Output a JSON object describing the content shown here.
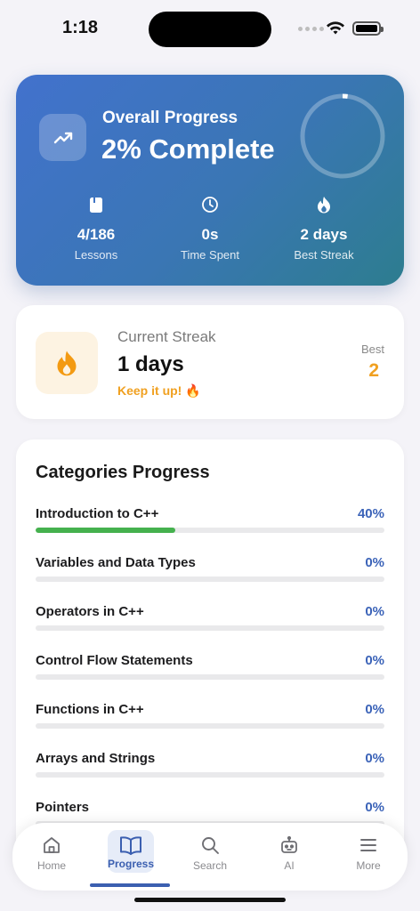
{
  "status_bar": {
    "time": "1:18"
  },
  "hero": {
    "title": "Overall Progress",
    "value": "2% Complete",
    "progress_fraction": 0.02,
    "stats": [
      {
        "icon": "book-icon",
        "value": "4/186",
        "label": "Lessons"
      },
      {
        "icon": "clock-icon",
        "value": "0s",
        "label": "Time Spent"
      },
      {
        "icon": "flame-icon",
        "value": "2 days",
        "label": "Best Streak"
      }
    ]
  },
  "streak": {
    "label": "Current Streak",
    "value": "1 days",
    "cheer": "Keep it up! 🔥",
    "best_label": "Best",
    "best_value": "2"
  },
  "categories": {
    "title": "Categories Progress",
    "items": [
      {
        "name": "Introduction to C++",
        "percent_label": "40%",
        "percent": 40
      },
      {
        "name": "Variables and Data Types",
        "percent_label": "0%",
        "percent": 0
      },
      {
        "name": "Operators in C++",
        "percent_label": "0%",
        "percent": 0
      },
      {
        "name": "Control Flow Statements",
        "percent_label": "0%",
        "percent": 0
      },
      {
        "name": "Functions in C++",
        "percent_label": "0%",
        "percent": 0
      },
      {
        "name": "Arrays and Strings",
        "percent_label": "0%",
        "percent": 0
      },
      {
        "name": "Pointers",
        "percent_label": "0%",
        "percent": 0
      }
    ]
  },
  "tabbar": {
    "active": "Progress",
    "tabs": [
      {
        "label": "Home",
        "icon": "home-icon"
      },
      {
        "label": "Progress",
        "icon": "book-open-icon"
      },
      {
        "label": "Search",
        "icon": "search-icon"
      },
      {
        "label": "AI",
        "icon": "robot-icon"
      },
      {
        "label": "More",
        "icon": "menu-icon"
      }
    ]
  },
  "colors": {
    "accent": "#3b5fb0",
    "success": "#45b14e",
    "streak": "#f0a020",
    "hero_gradient_start": "#4272cd",
    "hero_gradient_end": "#2d7d8f"
  }
}
